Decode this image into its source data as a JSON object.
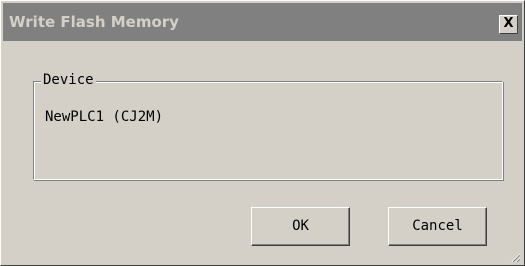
{
  "dialog": {
    "title": "Write Flash Memory",
    "close_label": "X"
  },
  "device_group": {
    "legend": "Device",
    "value": "NewPLC1 (CJ2M)"
  },
  "buttons": {
    "ok_label": "OK",
    "cancel_label": "Cancel"
  }
}
